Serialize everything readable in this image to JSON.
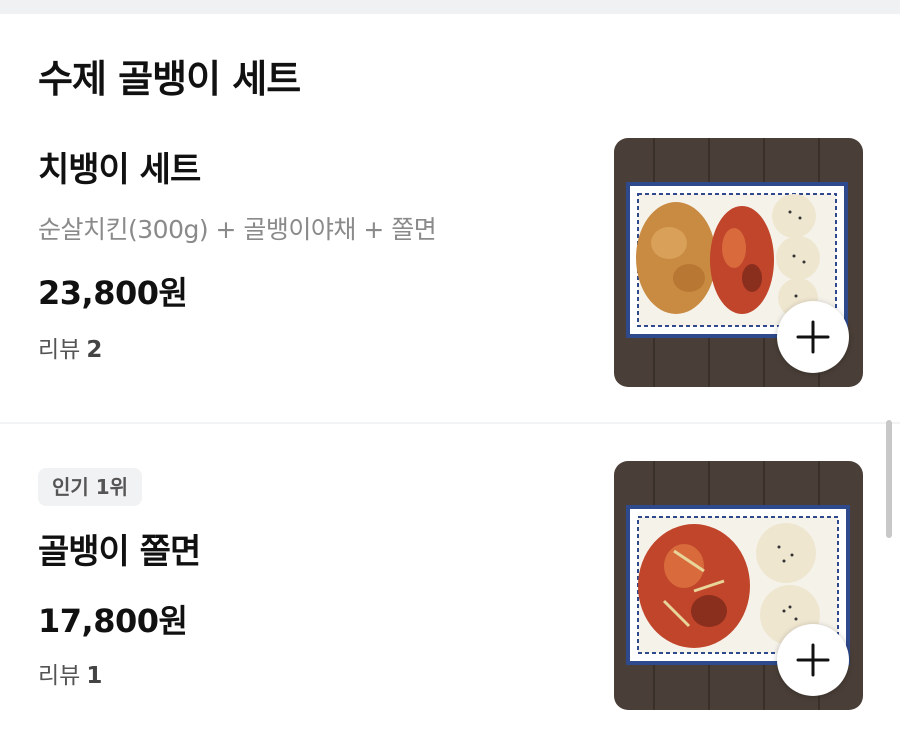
{
  "section": {
    "title": "수제 골뱅이 세트"
  },
  "menu_items": [
    {
      "name": "치뱅이 세트",
      "description": "순살치킨(300g) + 골뱅이야채 + 쫄면",
      "price": "23,800원",
      "review_label": "리뷰",
      "review_count": "2",
      "image_icon": "food-photo-chicken-golbaengi-set",
      "add_icon": "plus-icon"
    },
    {
      "badge": "인기 1위",
      "name": "골뱅이 쫄면",
      "price": "17,800원",
      "review_label": "리뷰",
      "review_count": "1",
      "image_icon": "food-photo-golbaengi-jjolmyeon",
      "add_icon": "plus-icon"
    }
  ],
  "colors": {
    "text_primary": "#111111",
    "text_secondary": "#8a8a8a",
    "badge_bg": "#f1f2f4",
    "top_bar": "#f0f1f3"
  }
}
